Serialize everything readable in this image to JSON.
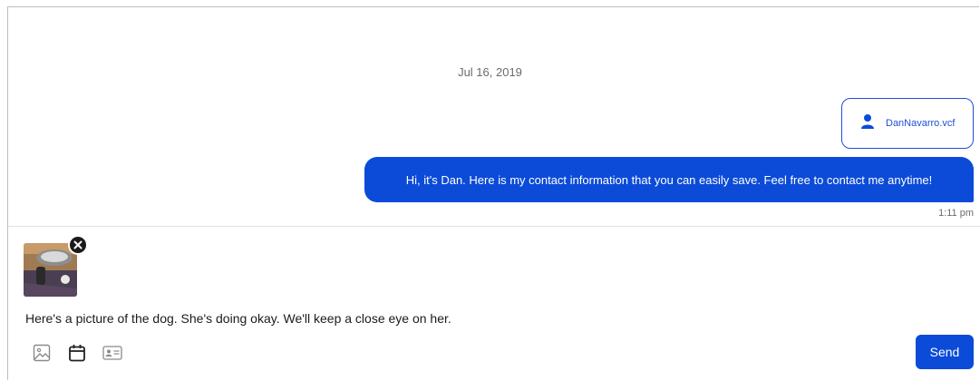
{
  "conversation": {
    "date_separator": "Jul 16, 2019",
    "messages": [
      {
        "attachment": {
          "type": "contact-card",
          "file_name": "DanNavarro.vcf"
        },
        "text": "Hi, it's Dan. Here is my contact information that you can easily save. Feel free to contact me anytime!",
        "time": "1:11 pm"
      }
    ]
  },
  "composer": {
    "attachment_icon": "photo-thumbnail",
    "message_text": "Here's a picture of the dog. She's doing okay. We'll keep a close eye on her.",
    "tools": [
      "image-icon",
      "calendar-icon",
      "contact-card-icon"
    ],
    "send_label": "Send"
  },
  "colors": {
    "accent": "#0b4bd8",
    "bubble_text": "#ffffff",
    "muted_text": "#6b6b6b"
  }
}
